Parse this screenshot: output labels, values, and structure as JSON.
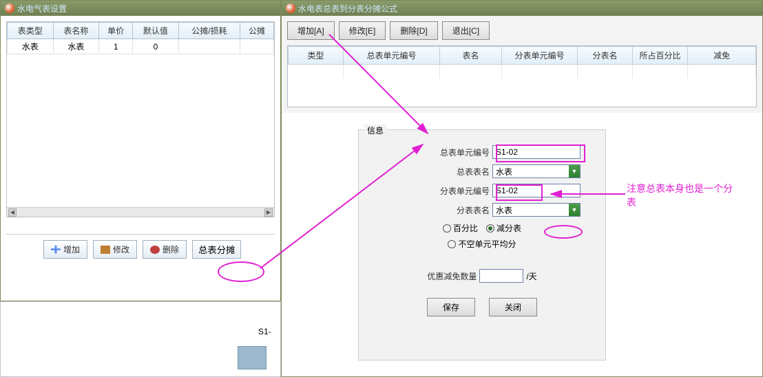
{
  "left_window": {
    "title": "水电气表设置",
    "headers": [
      "表类型",
      "表名称",
      "单价",
      "默认值",
      "公摊/损耗",
      "公摊"
    ],
    "row": {
      "type": "水表",
      "name": "水表",
      "price": "1",
      "default": "0",
      "gongtan": ""
    },
    "buttons": {
      "add": "增加",
      "edit": "修改",
      "del": "删除",
      "summary": "总表分摊"
    }
  },
  "right_window": {
    "title": "水电表总表到分表分摊公式",
    "top_buttons": {
      "add": "增加[A]",
      "edit": "修改[E]",
      "del": "删除[D]",
      "exit": "退出[C]"
    },
    "headers": [
      "类型",
      "总表单元编号",
      "表名",
      "分表单元编号",
      "分表名",
      "所占百分比",
      "减免"
    ]
  },
  "form": {
    "legend": "信息",
    "labels": {
      "main_unit": "总表单元编号",
      "main_name": "总表表名",
      "sub_unit": "分表单元编号",
      "sub_name": "分表表名",
      "discount_qty": "优惠减免数量",
      "unit_day": "/天"
    },
    "values": {
      "main_unit": "S1-02",
      "main_name": "水表",
      "sub_unit": "S1-02",
      "sub_name": "水表",
      "discount_qty": ""
    },
    "radios": {
      "percent": "百分比",
      "subtract": "减分表",
      "avg": "不空单元平均分"
    },
    "buttons": {
      "save": "保存",
      "close": "关闭"
    }
  },
  "annotation": "注意总表本身也是一个分表",
  "frag_label": "S1-"
}
